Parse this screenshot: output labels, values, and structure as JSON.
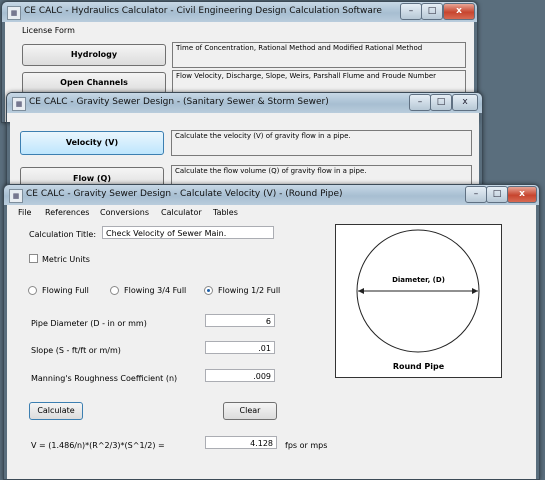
{
  "desktop": {
    "bg": "#5a6e7d"
  },
  "win1": {
    "title": "CE CALC - Hydraulics Calculator - Civil Engineering Design Calculation Software",
    "menu": [
      "License Form"
    ],
    "buttons": [
      {
        "label": "Hydrology",
        "desc": "Time of Concentration, Rational Method and Modified Rational Method"
      },
      {
        "label": "Open Channels",
        "desc": "Flow Velocity, Discharge, Slope, Weirs, Parshall Flume and Froude Number"
      }
    ]
  },
  "win2": {
    "title": "CE CALC - Gravity Sewer Design - (Sanitary Sewer & Storm Sewer)",
    "buttons": [
      {
        "label": "Velocity (V)",
        "desc": "Calculate the velocity (V) of gravity flow in a pipe."
      },
      {
        "label": "Flow (Q)",
        "desc": "Calculate the flow volume (Q) of gravity flow in a pipe."
      }
    ]
  },
  "win3": {
    "title": "CE CALC - Gravity Sewer Design - Calculate Velocity (V) - (Round Pipe)",
    "menu": [
      "File",
      "References",
      "Conversions",
      "Calculator",
      "Tables"
    ],
    "calc_title_label": "Calculation Title:",
    "calc_title_value": "Check Velocity of Sewer Main.",
    "metric_label": "Metric Units",
    "metric_checked": false,
    "flow_options": [
      "Flowing Full",
      "Flowing 3/4 Full",
      "Flowing 1/2 Full"
    ],
    "flow_selected": "Flowing 1/2 Full",
    "diameter_label": "Pipe Diameter (D - in or mm)",
    "diameter_value": "6",
    "slope_label": "Slope (S - ft/ft or m/m)",
    "slope_value": ".01",
    "manning_label": "Manning's Roughness Coefficient (n)",
    "manning_value": ".009",
    "calculate_label": "Calculate",
    "clear_label": "Clear",
    "formula": "V  = (1.486/n)*(R^2/3)*(S^1/2) =",
    "result_value": "4.128",
    "result_unit": "fps or mps",
    "diagram_dim_label": "Diameter, (D)",
    "diagram_caption": "Round Pipe"
  },
  "window_controls": {
    "minimize": "–",
    "maximize": "□",
    "close": "x"
  }
}
